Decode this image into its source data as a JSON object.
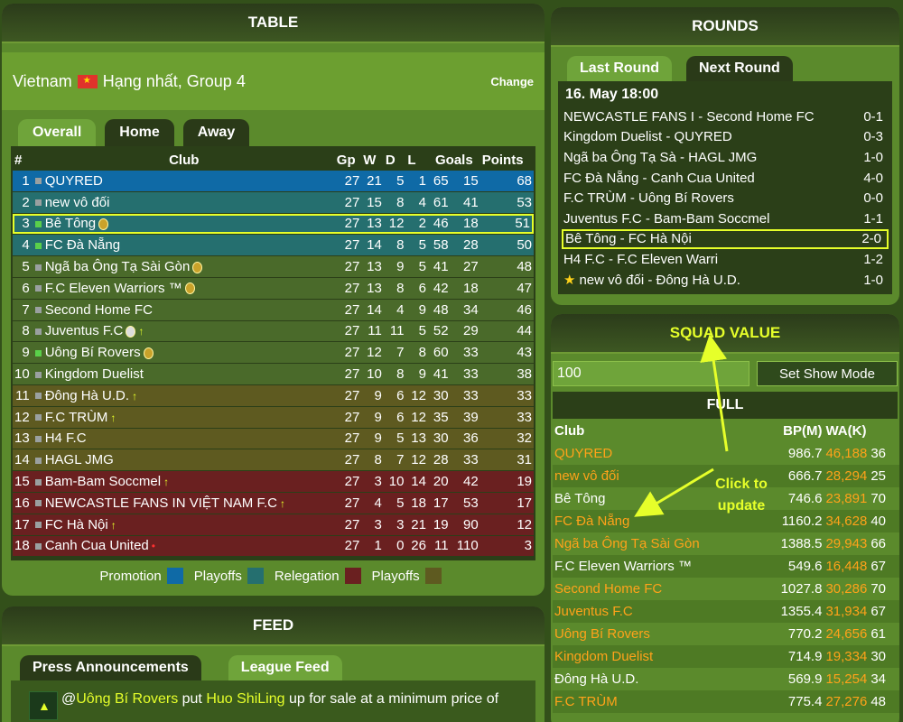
{
  "table": {
    "header": "TABLE",
    "country": "Vietnam",
    "competition": "Hạng nhất, Group 4",
    "change_label": "Change",
    "tabs": [
      "Overall",
      "Home",
      "Away"
    ],
    "columns": [
      "#",
      "Club",
      "Gp",
      "W",
      "D",
      "L",
      "Goals",
      "Points"
    ],
    "rows": [
      {
        "pos": "1",
        "club": "QUYRED",
        "gp": "27",
        "w": "21",
        "d": "5",
        "l": "1",
        "gf": "65",
        "ga": "15",
        "pts": "68",
        "zone": "promo"
      },
      {
        "pos": "2",
        "club": "new vô đối",
        "gp": "27",
        "w": "15",
        "d": "8",
        "l": "4",
        "gf": "61",
        "ga": "41",
        "pts": "53",
        "zone": "playoff"
      },
      {
        "pos": "3",
        "club": "Bê Tông",
        "gp": "27",
        "w": "13",
        "d": "12",
        "l": "2",
        "gf": "46",
        "ga": "18",
        "pts": "51",
        "zone": "playoff"
      },
      {
        "pos": "4",
        "club": "FC Đà Nẵng",
        "gp": "27",
        "w": "14",
        "d": "8",
        "l": "5",
        "gf": "58",
        "ga": "28",
        "pts": "50",
        "zone": "playoff"
      },
      {
        "pos": "5",
        "club": "Ngã ba Ông Tạ Sài Gòn",
        "gp": "27",
        "w": "13",
        "d": "9",
        "l": "5",
        "gf": "41",
        "ga": "27",
        "pts": "48",
        "zone": "mid"
      },
      {
        "pos": "6",
        "club": "F.C Eleven Warriors ™",
        "gp": "27",
        "w": "13",
        "d": "8",
        "l": "6",
        "gf": "42",
        "ga": "18",
        "pts": "47",
        "zone": "mid"
      },
      {
        "pos": "7",
        "club": "Second Home FC",
        "gp": "27",
        "w": "14",
        "d": "4",
        "l": "9",
        "gf": "48",
        "ga": "34",
        "pts": "46",
        "zone": "mid"
      },
      {
        "pos": "8",
        "club": "Juventus F.C",
        "gp": "27",
        "w": "11",
        "d": "11",
        "l": "5",
        "gf": "52",
        "ga": "29",
        "pts": "44",
        "zone": "mid"
      },
      {
        "pos": "9",
        "club": "Uông Bí Rovers",
        "gp": "27",
        "w": "12",
        "d": "7",
        "l": "8",
        "gf": "60",
        "ga": "33",
        "pts": "43",
        "zone": "mid"
      },
      {
        "pos": "10",
        "club": "Kingdom Duelist",
        "gp": "27",
        "w": "10",
        "d": "8",
        "l": "9",
        "gf": "41",
        "ga": "33",
        "pts": "38",
        "zone": "mid"
      },
      {
        "pos": "11",
        "club": "Đông Hà U.D.",
        "gp": "27",
        "w": "9",
        "d": "6",
        "l": "12",
        "gf": "30",
        "ga": "33",
        "pts": "33",
        "zone": "low"
      },
      {
        "pos": "12",
        "club": "F.C TRÙM",
        "gp": "27",
        "w": "9",
        "d": "6",
        "l": "12",
        "gf": "35",
        "ga": "39",
        "pts": "33",
        "zone": "low"
      },
      {
        "pos": "13",
        "club": "H4 F.C",
        "gp": "27",
        "w": "9",
        "d": "5",
        "l": "13",
        "gf": "30",
        "ga": "36",
        "pts": "32",
        "zone": "low"
      },
      {
        "pos": "14",
        "club": "HAGL JMG",
        "gp": "27",
        "w": "8",
        "d": "7",
        "l": "12",
        "gf": "28",
        "ga": "33",
        "pts": "31",
        "zone": "low"
      },
      {
        "pos": "15",
        "club": "Bam-Bam Soccmel",
        "gp": "27",
        "w": "3",
        "d": "10",
        "l": "14",
        "gf": "20",
        "ga": "42",
        "pts": "19",
        "zone": "releg"
      },
      {
        "pos": "16",
        "club": "NEWCASTLE FANS IN VIỆT NAM F.C",
        "gp": "27",
        "w": "4",
        "d": "5",
        "l": "18",
        "gf": "17",
        "ga": "53",
        "pts": "17",
        "zone": "releg"
      },
      {
        "pos": "17",
        "club": "FC Hà Nội",
        "gp": "27",
        "w": "3",
        "d": "3",
        "l": "21",
        "gf": "19",
        "ga": "90",
        "pts": "12",
        "zone": "releg"
      },
      {
        "pos": "18",
        "club": "Canh Cua United",
        "gp": "27",
        "w": "1",
        "d": "0",
        "l": "26",
        "gf": "11",
        "ga": "110",
        "pts": "3",
        "zone": "releg"
      }
    ],
    "legend": {
      "promotion": "Promotion",
      "playoffs1": "Playoffs",
      "relegation": "Relegation",
      "playoffs2": "Playoffs"
    },
    "colors": {
      "promo": "#0f6aa6",
      "playoff": "#256f6f",
      "releg": "#6a2020",
      "playoff2": "#5e5a20"
    }
  },
  "feed": {
    "header": "FEED",
    "tabs": [
      "Press Announcements",
      "League Feed"
    ],
    "item": {
      "at": "@",
      "club": "Uông Bí Rovers",
      "verb": " put ",
      "player": "Huo ShiLing",
      "rest": " up for sale at a minimum price of"
    }
  },
  "rounds": {
    "header": "ROUNDS",
    "tabs": [
      "Last Round",
      "Next Round"
    ],
    "date": "16. May 18:00",
    "matches": [
      {
        "teams": "NEWCASTLE FANS I - Second Home FC",
        "score": "0-1"
      },
      {
        "teams": "Kingdom Duelist - QUYRED",
        "score": "0-3"
      },
      {
        "teams": "Ngã ba Ông Tạ Sà - HAGL JMG",
        "score": "1-0"
      },
      {
        "teams": "FC Đà Nẵng - Canh Cua United",
        "score": "4-0"
      },
      {
        "teams": "F.C TRÙM - Uông Bí Rovers",
        "score": "0-0"
      },
      {
        "teams": "Juventus F.C - Bam-Bam Soccmel",
        "score": "1-1"
      },
      {
        "teams": "Bê Tông - FC Hà Nội",
        "score": "2-0"
      },
      {
        "teams": "H4 F.C - F.C Eleven Warri",
        "score": "1-2"
      },
      {
        "teams": "new vô đối - Đông Hà U.D.",
        "score": "1-0"
      }
    ]
  },
  "squad": {
    "header": "SQUAD VALUE",
    "input_value": "100",
    "button": "Set Show Mode",
    "subheader": "FULL",
    "columns": [
      "Club",
      "BP(M)",
      "WA(K)"
    ],
    "annotation": "Click to update",
    "rows": [
      {
        "club": "QUYRED",
        "bp": "986.7",
        "wa": "46,188",
        "x": "36",
        "orange": true
      },
      {
        "club": "new vô đối",
        "bp": "666.7",
        "wa": "28,294",
        "x": "25",
        "orange": true
      },
      {
        "club": "Bê Tông",
        "bp": "746.6",
        "wa": "23,891",
        "x": "70",
        "orange": false
      },
      {
        "club": "FC Đà Nẵng",
        "bp": "1160.2",
        "wa": "34,628",
        "x": "40",
        "orange": true
      },
      {
        "club": "Ngã ba Ông Tạ Sài Gòn",
        "bp": "1388.5",
        "wa": "29,943",
        "x": "66",
        "orange": true
      },
      {
        "club": "F.C Eleven Warriors ™",
        "bp": "549.6",
        "wa": "16,448",
        "x": "67",
        "orange": false
      },
      {
        "club": "Second Home FC",
        "bp": "1027.8",
        "wa": "30,286",
        "x": "70",
        "orange": true
      },
      {
        "club": "Juventus F.C",
        "bp": "1355.4",
        "wa": "31,934",
        "x": "67",
        "orange": true
      },
      {
        "club": "Uông Bí Rovers",
        "bp": "770.2",
        "wa": "24,656",
        "x": "61",
        "orange": true
      },
      {
        "club": "Kingdom Duelist",
        "bp": "714.9",
        "wa": "19,334",
        "x": "30",
        "orange": true
      },
      {
        "club": "Đông Hà U.D.",
        "bp": "569.9",
        "wa": "15,254",
        "x": "34",
        "orange": false
      },
      {
        "club": "F.C TRÙM",
        "bp": "775.4",
        "wa": "27,276",
        "x": "48",
        "orange": true
      }
    ]
  }
}
